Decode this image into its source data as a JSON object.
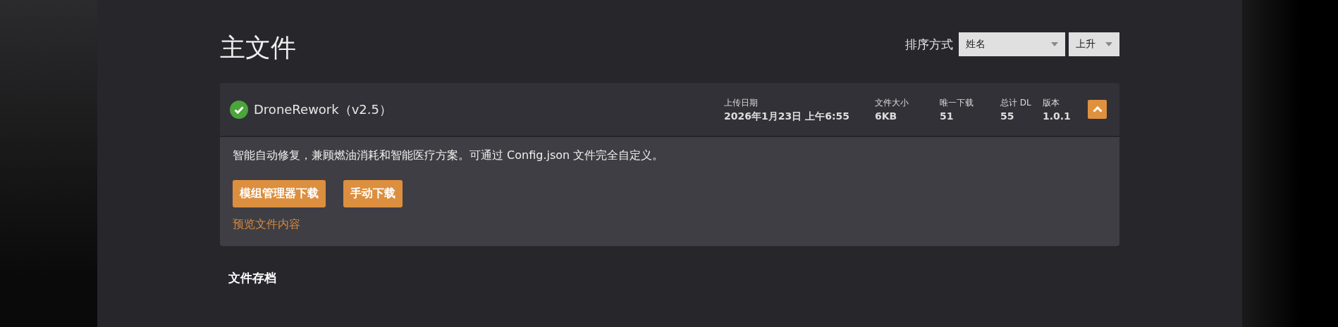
{
  "page_title": "主文件",
  "sort": {
    "label": "排序方式",
    "field": {
      "value": "姓名"
    },
    "order": {
      "value": "上升"
    }
  },
  "file": {
    "verified": true,
    "name": "DroneRework（v2.5）",
    "expanded": true,
    "stats": [
      {
        "label": "上传日期",
        "value": "2026年1月23日 上午6:55"
      },
      {
        "label": "文件大小",
        "value": "6KB"
      },
      {
        "label": "唯一下载",
        "value": "51"
      },
      {
        "label": "总计 DL",
        "value": "55"
      },
      {
        "label": "版本",
        "value": "1.0.1"
      }
    ],
    "description": "智能自动修复，兼顾燃油消耗和智能医疗方案。可通过 Config.json 文件完全自定义。",
    "buttons": [
      "模组管理器下载",
      "手动下载"
    ],
    "preview_link": "预览文件内容"
  },
  "archive_heading": "文件存档"
}
